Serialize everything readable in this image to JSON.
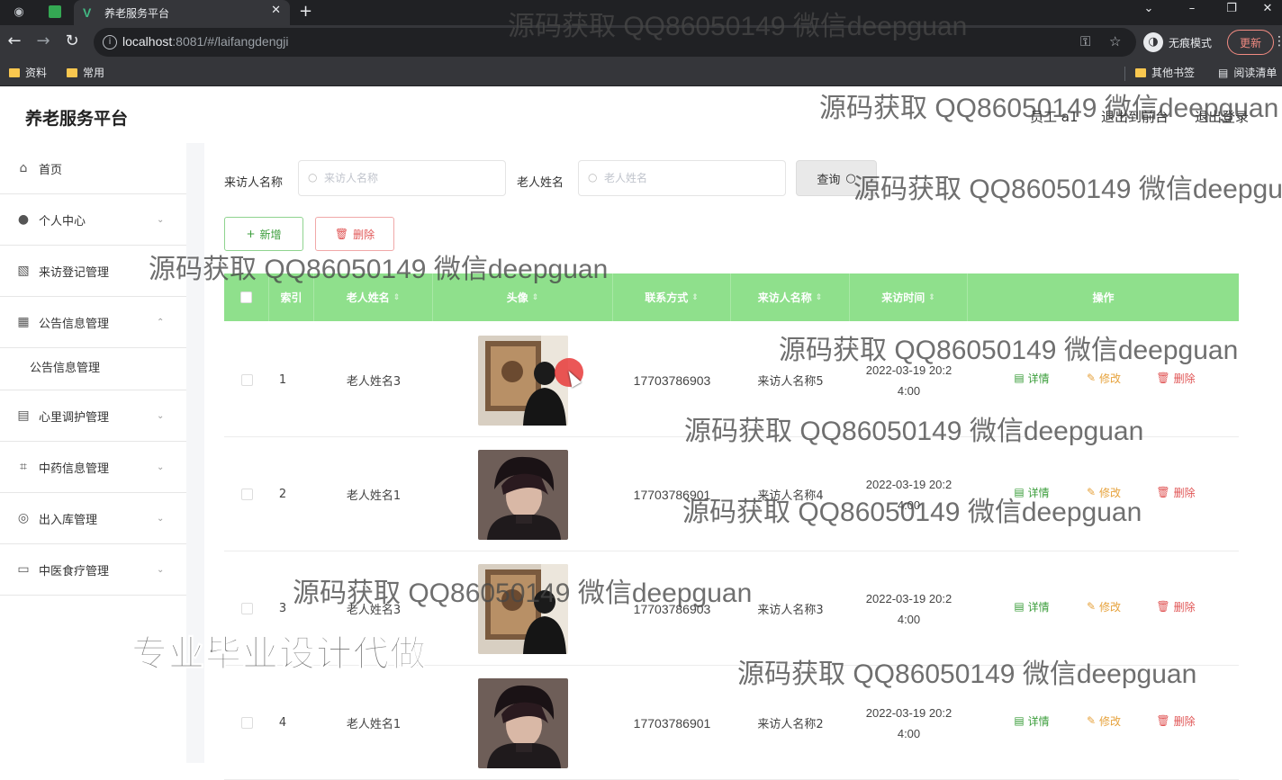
{
  "browser": {
    "tab_title": "养老服务平台",
    "url_host": "localhost",
    "url_rest": ":8081/#/laifangdengji",
    "incognito_label": "无痕模式",
    "update_label": "更新",
    "bookmarks": [
      "资料",
      "常用"
    ],
    "bookmarks_right": [
      "其他书签",
      "阅读清单"
    ]
  },
  "header": {
    "brand": "养老服务平台",
    "user": "员工 a1",
    "to_front": "退出到前台",
    "logout": "退出登录"
  },
  "sidebar": {
    "items": [
      {
        "label": "首页",
        "icon": "home-icon"
      },
      {
        "label": "个人中心",
        "icon": "user-icon"
      },
      {
        "label": "来访登记管理",
        "icon": "chart-icon"
      },
      {
        "label": "公告信息管理",
        "icon": "grid-icon"
      },
      {
        "label": "公告信息管理"
      },
      {
        "label": "心里调护管理",
        "icon": "document-icon"
      },
      {
        "label": "中药信息管理",
        "icon": "crop-icon"
      },
      {
        "label": "出入库管理",
        "icon": "target-icon"
      },
      {
        "label": "中医食疗管理",
        "icon": "briefcase-icon"
      }
    ]
  },
  "search": {
    "visitor_label": "来访人名称",
    "visitor_placeholder": "来访人名称",
    "elder_label": "老人姓名",
    "elder_placeholder": "老人姓名",
    "query_label": "查询"
  },
  "actions": {
    "add_label": "新增",
    "delete_label": "删除"
  },
  "table": {
    "columns": [
      "索引",
      "老人姓名",
      "头像",
      "联系方式",
      "来访人名称",
      "来访时间",
      "操作"
    ],
    "row_actions": {
      "detail": "详情",
      "edit": "修改",
      "delete": "删除"
    },
    "rows": [
      {
        "index": "1",
        "elder": "老人姓名3",
        "photo": "photo-painting",
        "phone": "17703786903",
        "visitor": "来访人名称5",
        "time_a": "2022-03-19 20:2",
        "time_b": "4:00"
      },
      {
        "index": "2",
        "elder": "老人姓名1",
        "photo": "photo-portrait",
        "phone": "17703786901",
        "visitor": "来访人名称4",
        "time_a": "2022-03-19 20:2",
        "time_b": "4:00"
      },
      {
        "index": "3",
        "elder": "老人姓名3",
        "photo": "photo-painting",
        "phone": "17703786903",
        "visitor": "来访人名称3",
        "time_a": "2022-03-19 20:2",
        "time_b": "4:00"
      },
      {
        "index": "4",
        "elder": "老人姓名1",
        "photo": "photo-portrait",
        "phone": "17703786901",
        "visitor": "来访人名称2",
        "time_a": "2022-03-19 20:2",
        "time_b": "4:00"
      }
    ]
  },
  "watermarks": {
    "text": "源码获取 QQ86050149 微信deepguan",
    "tagline": "专业毕业设计代做"
  },
  "colors": {
    "table_header": "#8fe08c",
    "add_green": "#3a9d3a",
    "delete_red": "#e05555",
    "edit_orange": "#e6a23c"
  }
}
